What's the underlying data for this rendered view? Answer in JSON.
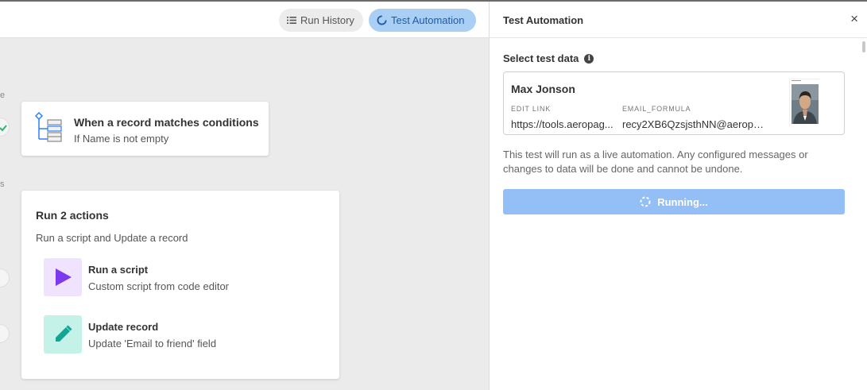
{
  "toolbar": {
    "run_history_label": "Run History",
    "test_automation_label": "Test Automation"
  },
  "trigger": {
    "title": "When a record matches conditions",
    "subtitle": "If Name is not empty"
  },
  "actions": {
    "title": "Run 2 actions",
    "subtitle": "Run a script and Update a record",
    "items": [
      {
        "title": "Run a script",
        "subtitle": "Custom script from code editor",
        "icon": "play-icon",
        "color": "#7c39ed",
        "bg": "#efe3ff"
      },
      {
        "title": "Update record",
        "subtitle": "Update 'Email to friend' field",
        "icon": "pencil-icon",
        "color": "#11a593",
        "bg": "#c5f2e8"
      }
    ]
  },
  "panel": {
    "title": "Test Automation",
    "close_label": "×",
    "select_label": "Select test data",
    "info_label": "i",
    "record": {
      "name": "Max Jonson",
      "fields": [
        {
          "label": "EDIT LINK",
          "value": "https://tools.aeropag..."
        },
        {
          "label": "EMAIL_FORMULA",
          "value": "recy2XB6QzsjsthNN@aeropa..."
        }
      ]
    },
    "note": "This test will run as a live automation. Any configured messages or changes to data will be done and cannot be undone.",
    "run_button_label": "Running..."
  },
  "colors": {
    "accent": "#1f5aa8",
    "running_button": "#93bff6",
    "test_pill": "#a9cff5"
  }
}
